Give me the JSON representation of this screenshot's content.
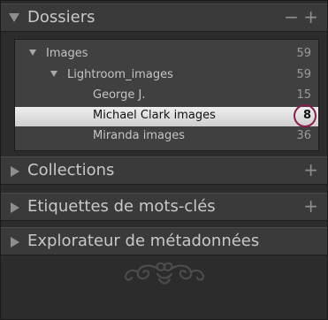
{
  "sections": {
    "dossiers": {
      "label": "Dossiers",
      "minus": "−",
      "plus": "+"
    },
    "collections": {
      "label": "Collections",
      "plus": "+"
    },
    "keywords": {
      "label": "Etiquettes de mots-clés",
      "plus": "+"
    },
    "metadata": {
      "label": "Explorateur de métadonnées"
    }
  },
  "folders": [
    {
      "name": "Images",
      "count": "59",
      "level": 0,
      "expanded": true,
      "selected": false
    },
    {
      "name": "Lightroom_images",
      "count": "59",
      "level": 1,
      "expanded": true,
      "selected": false
    },
    {
      "name": "George J.",
      "count": "15",
      "level": 2,
      "expanded": false,
      "selected": false
    },
    {
      "name": "Michael Clark images",
      "count": "8",
      "level": 2,
      "expanded": false,
      "selected": true
    },
    {
      "name": "Miranda images",
      "count": "36",
      "level": 2,
      "expanded": false,
      "selected": false
    }
  ],
  "colors": {
    "panel_bg": "#2c2c2c",
    "header_bg": "#3a3a3a",
    "folder_bg": "#404040",
    "selection": "#e0e0e0",
    "callout": "#8b1e4e"
  },
  "icons": {
    "expanded": "triangle-down-icon",
    "collapsed": "triangle-right-icon",
    "ornament": "flourish-ornament"
  }
}
